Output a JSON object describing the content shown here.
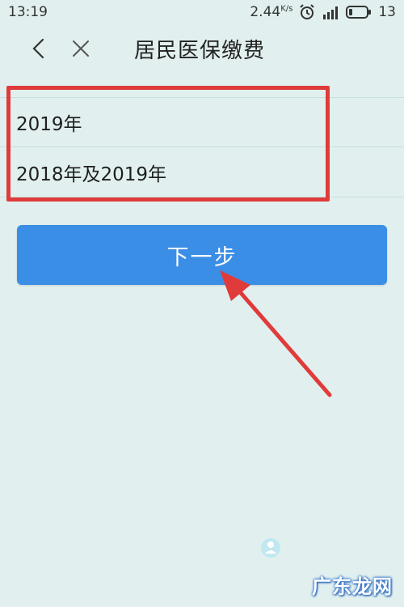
{
  "status_bar": {
    "time": "13:19",
    "speed_value": "2.44",
    "speed_unit": "K/s",
    "battery_level": "13"
  },
  "nav": {
    "title": "居民医保缴费"
  },
  "options": [
    {
      "label": "2019年"
    },
    {
      "label": "2018年及2019年"
    }
  ],
  "next_button": {
    "label": "下一步"
  },
  "watermark": {
    "text": "广东龙网"
  },
  "colors": {
    "background": "#e1f0ee",
    "button": "#3a8ee6",
    "annotation": "#e03b3b"
  }
}
